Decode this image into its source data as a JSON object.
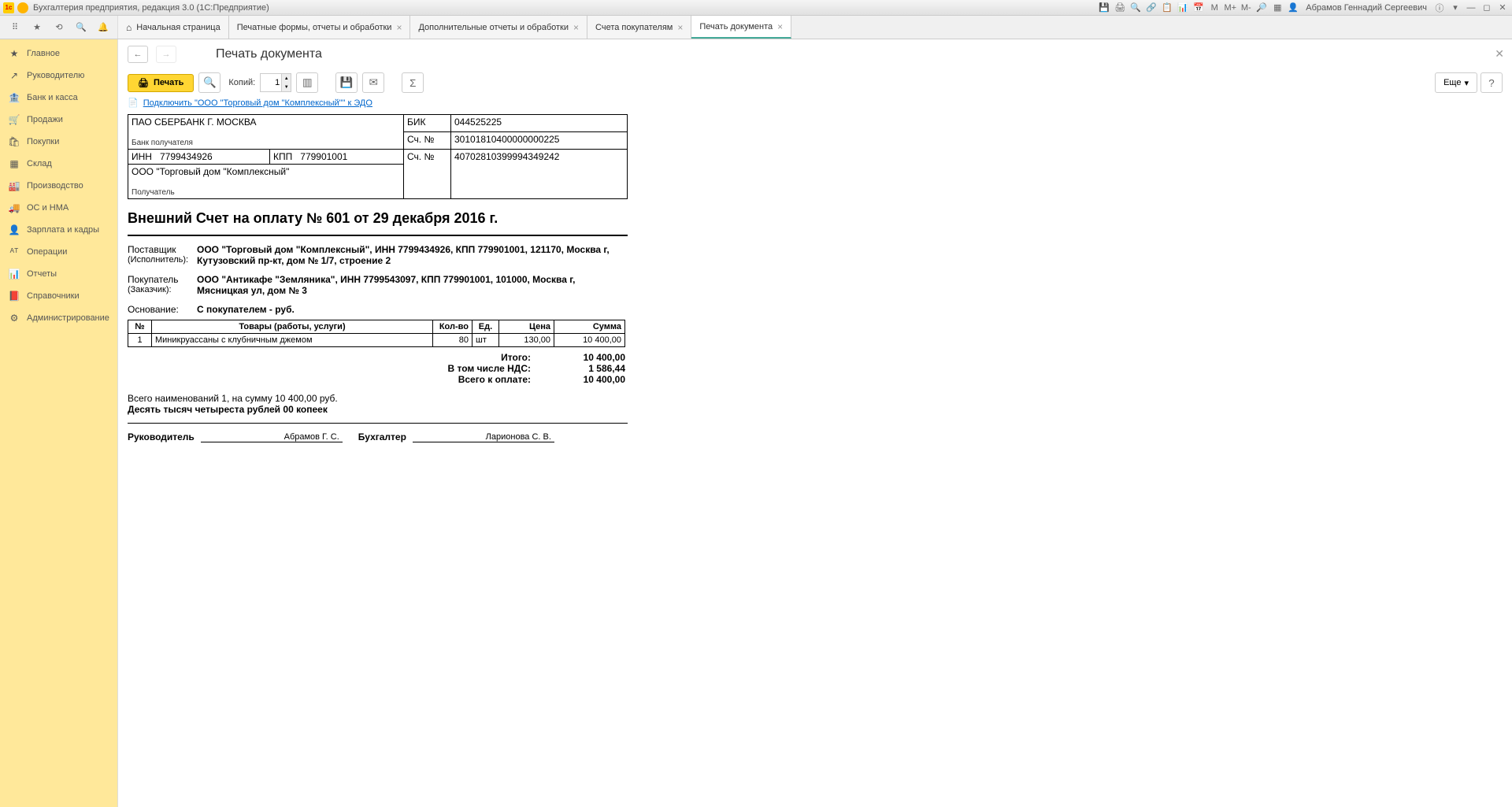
{
  "titlebar": {
    "title": "Бухгалтерия предприятия, редакция 3.0 (1С:Предприятие)",
    "user": "Абрамов Геннадий Сергеевич"
  },
  "tabs": [
    {
      "label": "Начальная страница",
      "home": true,
      "closable": false
    },
    {
      "label": "Печатные формы, отчеты и обработки",
      "closable": true
    },
    {
      "label": "Дополнительные отчеты и обработки",
      "closable": true
    },
    {
      "label": "Счета покупателям",
      "closable": true
    },
    {
      "label": "Печать документа",
      "closable": true,
      "active": true
    }
  ],
  "sidebar": [
    {
      "icon": "★",
      "label": "Главное"
    },
    {
      "icon": "↗",
      "label": "Руководителю"
    },
    {
      "icon": "🏦",
      "label": "Банк и касса"
    },
    {
      "icon": "🛒",
      "label": "Продажи"
    },
    {
      "icon": "🛍",
      "label": "Покупки"
    },
    {
      "icon": "▦",
      "label": "Склад"
    },
    {
      "icon": "🏭",
      "label": "Производство"
    },
    {
      "icon": "🚚",
      "label": "ОС и НМА"
    },
    {
      "icon": "👤",
      "label": "Зарплата и кадры"
    },
    {
      "icon": "ᴬᵀ",
      "label": "Операции"
    },
    {
      "icon": "📊",
      "label": "Отчеты"
    },
    {
      "icon": "📕",
      "label": "Справочники"
    },
    {
      "icon": "⚙",
      "label": "Администрирование"
    }
  ],
  "page": {
    "title": "Печать документа",
    "print_btn": "Печать",
    "copies_label": "Копий:",
    "copies_value": "1",
    "more_btn": "Еще",
    "help_btn": "?",
    "edo_link": "Подключить \"ООО \"Торговый дом \"Комплексный\"\" к ЭДО"
  },
  "doc": {
    "bank": {
      "bank_name": "ПАО СБЕРБАНК Г. МОСКВА",
      "bank_role": "Банк получателя",
      "bik_label": "БИК",
      "bik": "044525225",
      "acc_label": "Сч. №",
      "corr_acc": "30101810400000000225",
      "inn_label": "ИНН",
      "inn": "7799434926",
      "kpp_label": "КПП",
      "kpp": "779901001",
      "acc2_label": "Сч. №",
      "acc": "40702810399994349242",
      "recipient": "ООО \"Торговый дом \"Комплексный\"",
      "recipient_role": "Получатель"
    },
    "title": "Внешний Счет на оплату № 601 от 29 декабря 2016 г.",
    "supplier_label": "Поставщик",
    "supplier_sub": "(Исполнитель):",
    "supplier": "ООО \"Торговый дом \"Комплексный\", ИНН 7799434926, КПП 779901001, 121170, Москва г, Кутузовский пр-кт, дом № 1/7, строение 2",
    "buyer_label": "Покупатель",
    "buyer_sub": "(Заказчик):",
    "buyer": "ООО \"Антикафе \"Земляника\", ИНН 7799543097, КПП 779901001, 101000, Москва г, Мясницкая ул, дом № 3",
    "basis_label": "Основание:",
    "basis": "С покупателем - руб.",
    "cols": {
      "num": "№",
      "name": "Товары (работы, услуги)",
      "qty": "Кол-во",
      "unit": "Ед.",
      "price": "Цена",
      "sum": "Сумма"
    },
    "items": [
      {
        "num": "1",
        "name": "Миникруассаны с клубничным джемом",
        "qty": "80",
        "unit": "шт",
        "price": "130,00",
        "sum": "10 400,00"
      }
    ],
    "totals": {
      "itogo_label": "Итого:",
      "itogo": "10 400,00",
      "nds_label": "В том числе НДС:",
      "nds": "1 586,44",
      "total_label": "Всего к оплате:",
      "total": "10 400,00"
    },
    "summary_line": "Всего наименований 1, на сумму 10 400,00 руб.",
    "summary_words": "Десять тысяч четыреста рублей 00 копеек",
    "sign": {
      "director_label": "Руководитель",
      "director": "Абрамов Г. С.",
      "accountant_label": "Бухгалтер",
      "accountant": "Ларионова С. В."
    }
  }
}
